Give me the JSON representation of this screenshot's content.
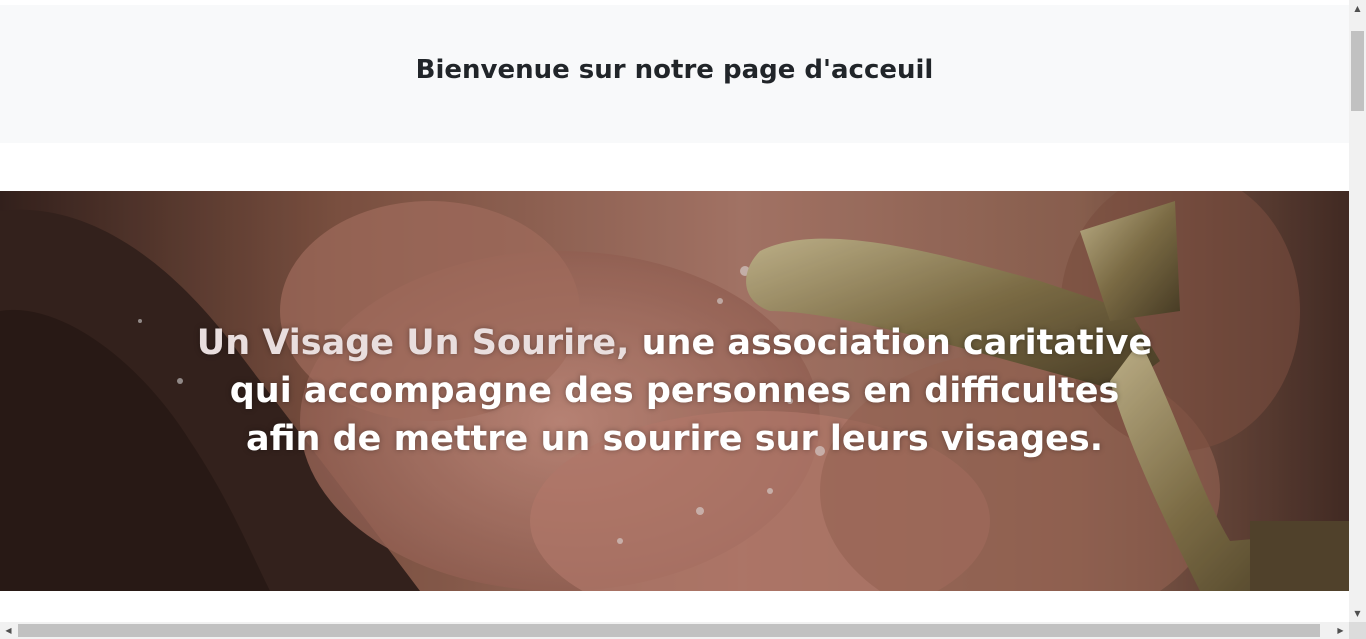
{
  "header": {
    "title": "Bienvenue sur notre page d'acceuil"
  },
  "hero": {
    "brand": "Un Visage Un Sourire,",
    "line1_rest": " une association caritative",
    "line2": "qui accompagne des personnes en difficultes",
    "line3": "afin de mettre un sourire sur leurs visages.",
    "image_icon": "hands-water-tap-photo"
  },
  "scrollbars": {
    "up_arrow": "▲",
    "down_arrow": "▼",
    "left_arrow": "◀",
    "right_arrow": "▶"
  },
  "colors": {
    "header_bg": "#f8f9fa",
    "title_text": "#212529",
    "hero_text": "#ffffff",
    "brand_text": "#e9dede"
  }
}
